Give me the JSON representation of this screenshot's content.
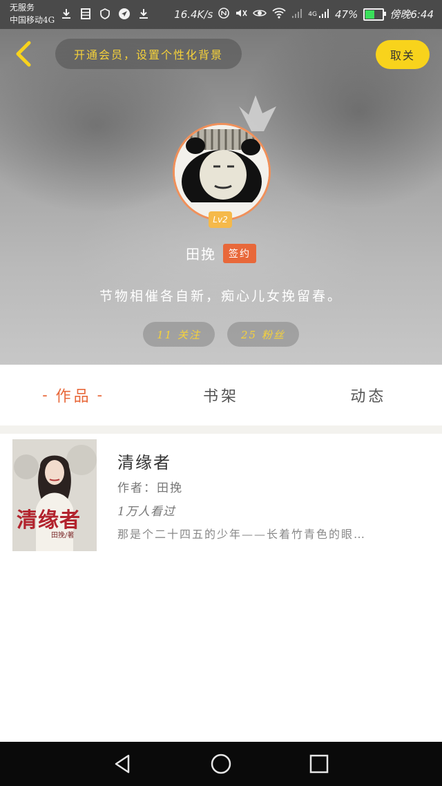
{
  "status_bar": {
    "line1": "无服务",
    "line2": "中国移动4G",
    "network_speed": "16.4K/s",
    "network_type": "4G",
    "battery_percent": "47%",
    "battery_level": 0.47,
    "time": "傍晚6:44",
    "icons": [
      "download-icon",
      "storage-icon",
      "shield-icon",
      "location-icon",
      "download-icon",
      "nfc-icon",
      "mute-icon",
      "eye-icon",
      "wifi-icon",
      "signal-icon",
      "signal-icon",
      "battery-icon"
    ]
  },
  "header": {
    "vip_banner": "开通会员，设置个性化背景",
    "unfollow_label": "取关",
    "level_badge": "Lv2",
    "username": "田挽",
    "sign_badge": "签约",
    "signature": "节物相催各自新，痴心儿女挽留春。",
    "following": "11 关注",
    "followers": "25 粉丝",
    "accent_color": "#f8d31c"
  },
  "tabs": [
    {
      "label": "作品",
      "active": true
    },
    {
      "label": "书架",
      "active": false
    },
    {
      "label": "动态",
      "active": false
    }
  ],
  "tab_active_dash": "-",
  "book": {
    "cover_title": "清缘者",
    "cover_author": "田挽/著",
    "title": "清缘者",
    "author": "作者：田挽",
    "views": "1万人看过",
    "description": "那是个二十四五的少年——长着竹青色的眼…"
  },
  "colors": {
    "accent_orange": "#e8683a",
    "gold": "#f6d23a"
  }
}
